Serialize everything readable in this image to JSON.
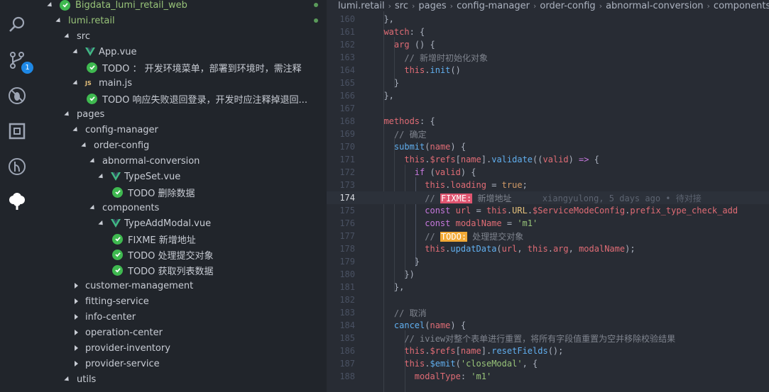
{
  "explorer": {
    "items": [
      {
        "label": "Bigdata_lumi_retail_web",
        "indent": 0,
        "arrow": "down",
        "icon": "check",
        "green": true,
        "dot": true
      },
      {
        "label": "lumi.retail",
        "indent": 1,
        "arrow": "down",
        "icon": "",
        "green": true,
        "dot": true
      },
      {
        "label": "src",
        "indent": 2,
        "arrow": "down",
        "icon": ""
      },
      {
        "label": "App.vue",
        "indent": 3,
        "arrow": "down",
        "icon": "vue"
      },
      {
        "label": "TODO ： 开发环境菜单，部署到环境时，需注释",
        "indent": 4,
        "arrow": "",
        "icon": "check"
      },
      {
        "label": "main.js",
        "indent": 3,
        "arrow": "down",
        "icon": "js"
      },
      {
        "label": "TODO 响应失败退回登录，开发时应注释掉退回...",
        "indent": 4,
        "arrow": "",
        "icon": "check"
      },
      {
        "label": "pages",
        "indent": 2,
        "arrow": "down",
        "icon": ""
      },
      {
        "label": "config-manager",
        "indent": 3,
        "arrow": "down",
        "icon": ""
      },
      {
        "label": "order-config",
        "indent": 4,
        "arrow": "down",
        "icon": ""
      },
      {
        "label": "abnormal-conversion",
        "indent": 5,
        "arrow": "down",
        "icon": ""
      },
      {
        "label": "TypeSet.vue",
        "indent": 6,
        "arrow": "down",
        "icon": "vue"
      },
      {
        "label": "TODO 删除数据",
        "indent": 7,
        "arrow": "",
        "icon": "check"
      },
      {
        "label": "components",
        "indent": 5,
        "arrow": "down",
        "icon": ""
      },
      {
        "label": "TypeAddModal.vue",
        "indent": 6,
        "arrow": "down",
        "icon": "vue"
      },
      {
        "label": "FIXME 新增地址",
        "indent": 7,
        "arrow": "",
        "icon": "check"
      },
      {
        "label": "TODO 处理提交对象",
        "indent": 7,
        "arrow": "",
        "icon": "check"
      },
      {
        "label": "TODO 获取列表数据",
        "indent": 7,
        "arrow": "",
        "icon": "check"
      },
      {
        "label": "customer-management",
        "indent": 3,
        "arrow": "right",
        "icon": ""
      },
      {
        "label": "fitting-service",
        "indent": 3,
        "arrow": "right",
        "icon": ""
      },
      {
        "label": "info-center",
        "indent": 3,
        "arrow": "right",
        "icon": ""
      },
      {
        "label": "operation-center",
        "indent": 3,
        "arrow": "right",
        "icon": ""
      },
      {
        "label": "provider-inventory",
        "indent": 3,
        "arrow": "right",
        "icon": ""
      },
      {
        "label": "provider-service",
        "indent": 3,
        "arrow": "right",
        "icon": ""
      },
      {
        "label": "utils",
        "indent": 2,
        "arrow": "down",
        "icon": ""
      }
    ]
  },
  "activity": {
    "source_control_badge": "1"
  },
  "breadcrumb": [
    "lumi.retail",
    "src",
    "pages",
    "config-manager",
    "order-config",
    "abnormal-conversion",
    "components"
  ],
  "editor": {
    "current_line": 174,
    "lines": [
      {
        "n": 160,
        "html": "  <span class='p'>},</span>"
      },
      {
        "n": 161,
        "html": "  <span class='t'>watch</span><span class='p'>: {</span>"
      },
      {
        "n": 162,
        "html": "    <span class='t'>arg</span> <span class='p'>() {</span>"
      },
      {
        "n": 163,
        "html": "      <span class='c'>// 新增时初始化对象</span>"
      },
      {
        "n": 164,
        "html": "      <span class='t'>this</span><span class='p'>.</span><span class='f'>init</span><span class='p'>()</span>"
      },
      {
        "n": 165,
        "html": "    <span class='p'>}</span>"
      },
      {
        "n": 166,
        "html": "  <span class='p'>},</span>"
      },
      {
        "n": 167,
        "html": ""
      },
      {
        "n": 168,
        "html": "  <span class='t'>methods</span><span class='p'>: {</span>"
      },
      {
        "n": 169,
        "html": "    <span class='c'>// 确定</span>"
      },
      {
        "n": 170,
        "html": "    <span class='f'>submit</span><span class='p'>(</span><span class='t'>name</span><span class='p'>) {</span>"
      },
      {
        "n": 171,
        "html": "      <span class='t'>this</span><span class='p'>.</span><span class='t'>$refs</span><span class='p'>[</span><span class='t'>name</span><span class='p'>].</span><span class='f'>validate</span><span class='p'>((</span><span class='t'>valid</span><span class='p'>) </span><span class='k'>=&gt;</span><span class='p'> {</span>"
      },
      {
        "n": 172,
        "html": "        <span class='k'>if</span><span class='p'> (</span><span class='t'>valid</span><span class='p'>) {</span>"
      },
      {
        "n": 173,
        "html": "          <span class='t'>this</span><span class='p'>.</span><span class='t'>loading</span><span class='p'> = </span><span class='n'>true</span><span class='p'>;</span>"
      },
      {
        "n": 174,
        "html": "          <span class='c'>// </span><span class='fixme'>FIXME:</span><span class='c'> 新增地址</span>      <span class='blame'>xiangyulong, 5 days ago • 待对接</span>"
      },
      {
        "n": 175,
        "html": "          <span class='k'>const</span><span class='p'> </span><span class='t'>url</span><span class='p'> = </span><span class='t'>this</span><span class='p'>.</span><span class='y'>URL</span><span class='p'>.</span><span class='t'>$ServiceModeConfig</span><span class='p'>.</span><span class='t'>prefix_type_check_add</span>"
      },
      {
        "n": 176,
        "html": "          <span class='k'>const</span><span class='p'> </span><span class='t'>modalName</span><span class='p'> = </span><span class='s'>'m1'</span>"
      },
      {
        "n": 177,
        "html": "          <span class='c'>// </span><span class='todo'>TODO:</span><span class='c'> 处理提交对象</span>"
      },
      {
        "n": 178,
        "html": "          <span class='t'>this</span><span class='p'>.</span><span class='f'>updatData</span><span class='p'>(</span><span class='t'>url</span><span class='p'>, </span><span class='t'>this</span><span class='p'>.</span><span class='t'>arg</span><span class='p'>, </span><span class='t'>modalName</span><span class='p'>);</span>"
      },
      {
        "n": 179,
        "html": "        <span class='p'>}</span>"
      },
      {
        "n": 180,
        "html": "      <span class='p'>})</span>"
      },
      {
        "n": 181,
        "html": "    <span class='p'>},</span>"
      },
      {
        "n": 182,
        "html": ""
      },
      {
        "n": 183,
        "html": "    <span class='c'>// 取消</span>"
      },
      {
        "n": 184,
        "html": "    <span class='f'>cancel</span><span class='p'>(</span><span class='t'>name</span><span class='p'>) {</span>"
      },
      {
        "n": 185,
        "html": "      <span class='c'>// iview对整个表单进行重置，将所有字段值重置为空并移除校验结果</span>"
      },
      {
        "n": 186,
        "html": "      <span class='t'>this</span><span class='p'>.</span><span class='t'>$refs</span><span class='p'>[</span><span class='t'>name</span><span class='p'>].</span><span class='f'>resetFields</span><span class='p'>();</span>"
      },
      {
        "n": 187,
        "html": "      <span class='t'>this</span><span class='p'>.</span><span class='f'>$emit</span><span class='p'>(</span><span class='s'>'closeModal'</span><span class='p'>, {</span>"
      },
      {
        "n": 188,
        "html": "        <span class='t'>modalType</span><span class='p'>: </span><span class='s'>'m1'</span>"
      }
    ]
  }
}
